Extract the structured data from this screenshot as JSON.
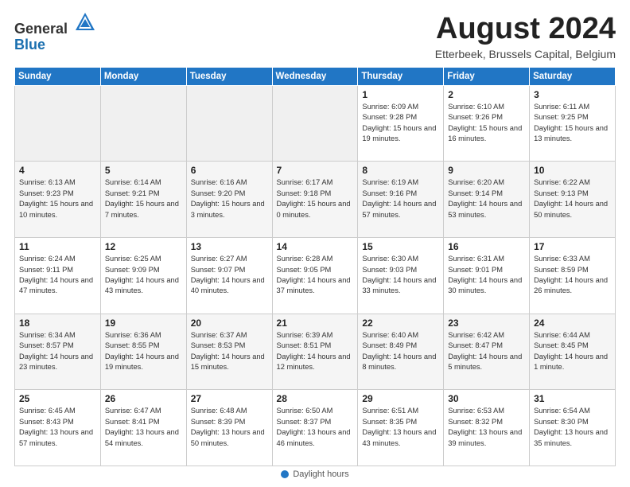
{
  "header": {
    "logo_general": "General",
    "logo_blue": "Blue",
    "month_title": "August 2024",
    "subtitle": "Etterbeek, Brussels Capital, Belgium"
  },
  "footer": {
    "label": "Daylight hours"
  },
  "days_of_week": [
    "Sunday",
    "Monday",
    "Tuesday",
    "Wednesday",
    "Thursday",
    "Friday",
    "Saturday"
  ],
  "weeks": [
    [
      {
        "day": "",
        "info": ""
      },
      {
        "day": "",
        "info": ""
      },
      {
        "day": "",
        "info": ""
      },
      {
        "day": "",
        "info": ""
      },
      {
        "day": "1",
        "info": "Sunrise: 6:09 AM\nSunset: 9:28 PM\nDaylight: 15 hours\nand 19 minutes."
      },
      {
        "day": "2",
        "info": "Sunrise: 6:10 AM\nSunset: 9:26 PM\nDaylight: 15 hours\nand 16 minutes."
      },
      {
        "day": "3",
        "info": "Sunrise: 6:11 AM\nSunset: 9:25 PM\nDaylight: 15 hours\nand 13 minutes."
      }
    ],
    [
      {
        "day": "4",
        "info": "Sunrise: 6:13 AM\nSunset: 9:23 PM\nDaylight: 15 hours\nand 10 minutes."
      },
      {
        "day": "5",
        "info": "Sunrise: 6:14 AM\nSunset: 9:21 PM\nDaylight: 15 hours\nand 7 minutes."
      },
      {
        "day": "6",
        "info": "Sunrise: 6:16 AM\nSunset: 9:20 PM\nDaylight: 15 hours\nand 3 minutes."
      },
      {
        "day": "7",
        "info": "Sunrise: 6:17 AM\nSunset: 9:18 PM\nDaylight: 15 hours\nand 0 minutes."
      },
      {
        "day": "8",
        "info": "Sunrise: 6:19 AM\nSunset: 9:16 PM\nDaylight: 14 hours\nand 57 minutes."
      },
      {
        "day": "9",
        "info": "Sunrise: 6:20 AM\nSunset: 9:14 PM\nDaylight: 14 hours\nand 53 minutes."
      },
      {
        "day": "10",
        "info": "Sunrise: 6:22 AM\nSunset: 9:13 PM\nDaylight: 14 hours\nand 50 minutes."
      }
    ],
    [
      {
        "day": "11",
        "info": "Sunrise: 6:24 AM\nSunset: 9:11 PM\nDaylight: 14 hours\nand 47 minutes."
      },
      {
        "day": "12",
        "info": "Sunrise: 6:25 AM\nSunset: 9:09 PM\nDaylight: 14 hours\nand 43 minutes."
      },
      {
        "day": "13",
        "info": "Sunrise: 6:27 AM\nSunset: 9:07 PM\nDaylight: 14 hours\nand 40 minutes."
      },
      {
        "day": "14",
        "info": "Sunrise: 6:28 AM\nSunset: 9:05 PM\nDaylight: 14 hours\nand 37 minutes."
      },
      {
        "day": "15",
        "info": "Sunrise: 6:30 AM\nSunset: 9:03 PM\nDaylight: 14 hours\nand 33 minutes."
      },
      {
        "day": "16",
        "info": "Sunrise: 6:31 AM\nSunset: 9:01 PM\nDaylight: 14 hours\nand 30 minutes."
      },
      {
        "day": "17",
        "info": "Sunrise: 6:33 AM\nSunset: 8:59 PM\nDaylight: 14 hours\nand 26 minutes."
      }
    ],
    [
      {
        "day": "18",
        "info": "Sunrise: 6:34 AM\nSunset: 8:57 PM\nDaylight: 14 hours\nand 23 minutes."
      },
      {
        "day": "19",
        "info": "Sunrise: 6:36 AM\nSunset: 8:55 PM\nDaylight: 14 hours\nand 19 minutes."
      },
      {
        "day": "20",
        "info": "Sunrise: 6:37 AM\nSunset: 8:53 PM\nDaylight: 14 hours\nand 15 minutes."
      },
      {
        "day": "21",
        "info": "Sunrise: 6:39 AM\nSunset: 8:51 PM\nDaylight: 14 hours\nand 12 minutes."
      },
      {
        "day": "22",
        "info": "Sunrise: 6:40 AM\nSunset: 8:49 PM\nDaylight: 14 hours\nand 8 minutes."
      },
      {
        "day": "23",
        "info": "Sunrise: 6:42 AM\nSunset: 8:47 PM\nDaylight: 14 hours\nand 5 minutes."
      },
      {
        "day": "24",
        "info": "Sunrise: 6:44 AM\nSunset: 8:45 PM\nDaylight: 14 hours\nand 1 minute."
      }
    ],
    [
      {
        "day": "25",
        "info": "Sunrise: 6:45 AM\nSunset: 8:43 PM\nDaylight: 13 hours\nand 57 minutes."
      },
      {
        "day": "26",
        "info": "Sunrise: 6:47 AM\nSunset: 8:41 PM\nDaylight: 13 hours\nand 54 minutes."
      },
      {
        "day": "27",
        "info": "Sunrise: 6:48 AM\nSunset: 8:39 PM\nDaylight: 13 hours\nand 50 minutes."
      },
      {
        "day": "28",
        "info": "Sunrise: 6:50 AM\nSunset: 8:37 PM\nDaylight: 13 hours\nand 46 minutes."
      },
      {
        "day": "29",
        "info": "Sunrise: 6:51 AM\nSunset: 8:35 PM\nDaylight: 13 hours\nand 43 minutes."
      },
      {
        "day": "30",
        "info": "Sunrise: 6:53 AM\nSunset: 8:32 PM\nDaylight: 13 hours\nand 39 minutes."
      },
      {
        "day": "31",
        "info": "Sunrise: 6:54 AM\nSunset: 8:30 PM\nDaylight: 13 hours\nand 35 minutes."
      }
    ]
  ]
}
